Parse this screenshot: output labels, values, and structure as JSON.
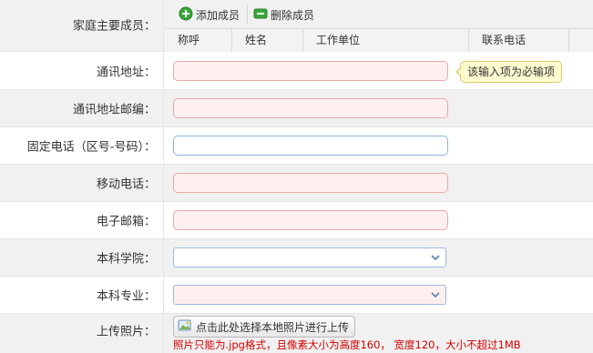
{
  "family": {
    "label": "家庭主要成员：",
    "add_button": "添加成员",
    "delete_button": "删除成员",
    "columns": [
      "称呼",
      "姓名",
      "工作单位",
      "联系电话"
    ]
  },
  "fields": {
    "address": {
      "label": "通讯地址：",
      "value": ""
    },
    "postcode": {
      "label": "通讯地址邮编：",
      "value": ""
    },
    "phone": {
      "label": "固定电话（区号-号码）：",
      "value": ""
    },
    "mobile": {
      "label": "移动电话：",
      "value": ""
    },
    "email": {
      "label": "电子邮箱：",
      "value": ""
    },
    "college": {
      "label": "本科学院：",
      "value": ""
    },
    "major": {
      "label": "本科专业：",
      "value": ""
    },
    "photo": {
      "label": "上传照片：",
      "button": "点击此处选择本地照片进行上传",
      "hint": "照片只能为.jpg格式，且像素大小为高度160， 宽度120，大小不超过1MB"
    }
  },
  "tooltip": "该输入项为必输项",
  "colors": {
    "required_bg": "#fff0f0",
    "required_border": "#e8a9a9",
    "hint": "#d40000",
    "row_gray": "#f1f1f1"
  }
}
